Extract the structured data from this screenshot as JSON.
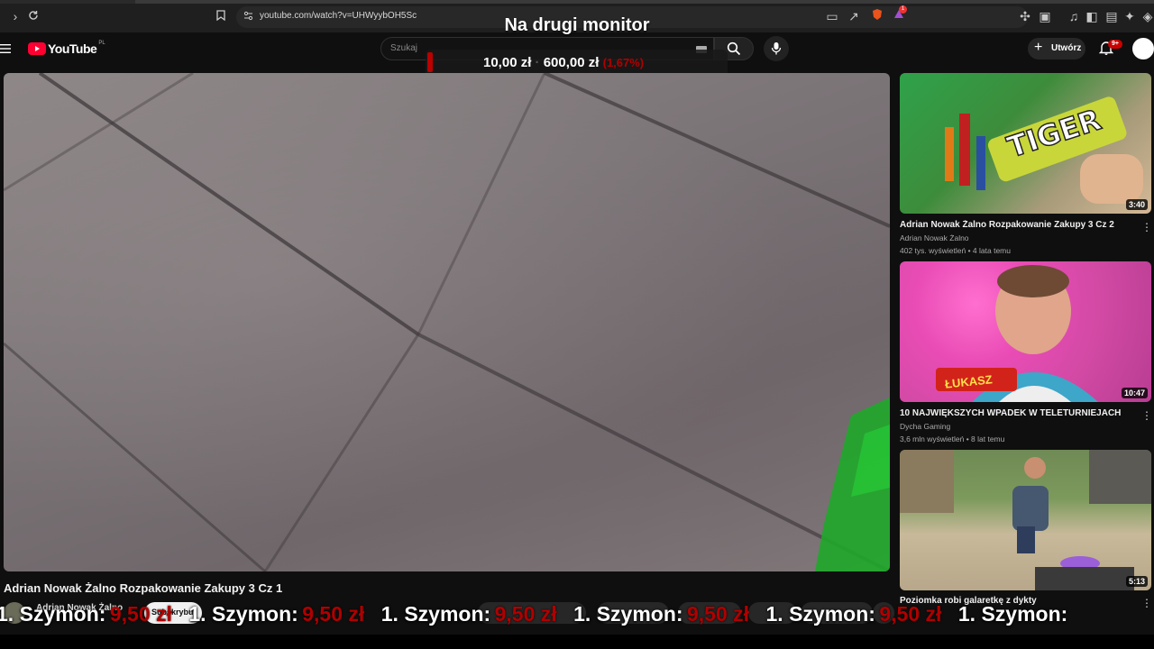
{
  "browser": {
    "url": "youtube.com/watch?v=UHWyybOH5Sc",
    "extension_badge": "1"
  },
  "overlay": {
    "title": "Na drugi monitor",
    "donation_current": "10,00 zł",
    "donation_goal": "600,00 zł",
    "donation_percent": "(1,67%)",
    "donation_progress": 0.0167
  },
  "yt": {
    "logo_text": "YouTube",
    "region": "PL",
    "search_placeholder": "Szukaj",
    "create_label": "Utwórz",
    "notifications_count": "9+"
  },
  "video": {
    "title": "Adrian Nowak Żalno Rozpakowanie Zakupy 3 Cz 1",
    "channel": "Adrian Nowak Żalno",
    "subscribe_label": "Subskrybuj"
  },
  "recommendations": [
    {
      "title": "Adrian Nowak Żalno Rozpakowanie Zakupy 3 Cz 2",
      "channel": "Adrian Nowak Żalno",
      "views": "402 tys. wyświetleń • 4 lata temu",
      "duration": "3:40",
      "thumb_text": "TIGER"
    },
    {
      "title": "10 NAJWIĘKSZYCH WPADEK W TELETURNIEJACH",
      "channel": "Dycha Gaming",
      "views": "3,6 mln wyświetleń • 8 lat temu",
      "duration": "10:47",
      "thumb_text": "ŁUKASZ"
    },
    {
      "title": "Poziomka robi galaretkę z dykty",
      "channel": "",
      "views": "",
      "duration": "5:13",
      "thumb_text": ""
    }
  ],
  "ticker": {
    "items": [
      {
        "name": "1. Szymon:",
        "amount": "9,50 zł"
      },
      {
        "name": "1. Szymon:",
        "amount": "9,50 zł"
      },
      {
        "name": "1. Szymon:",
        "amount": "9,50 zł"
      },
      {
        "name": "1. Szymon:",
        "amount": "9,50 zł"
      },
      {
        "name": "1. Szymon:",
        "amount": "9,50 zł"
      },
      {
        "name": "1. Szymon:",
        "amount": ""
      }
    ]
  },
  "colors": {
    "accent_red": "#ff0033",
    "donation_red": "#b00000",
    "background": "#0f0f0f"
  }
}
